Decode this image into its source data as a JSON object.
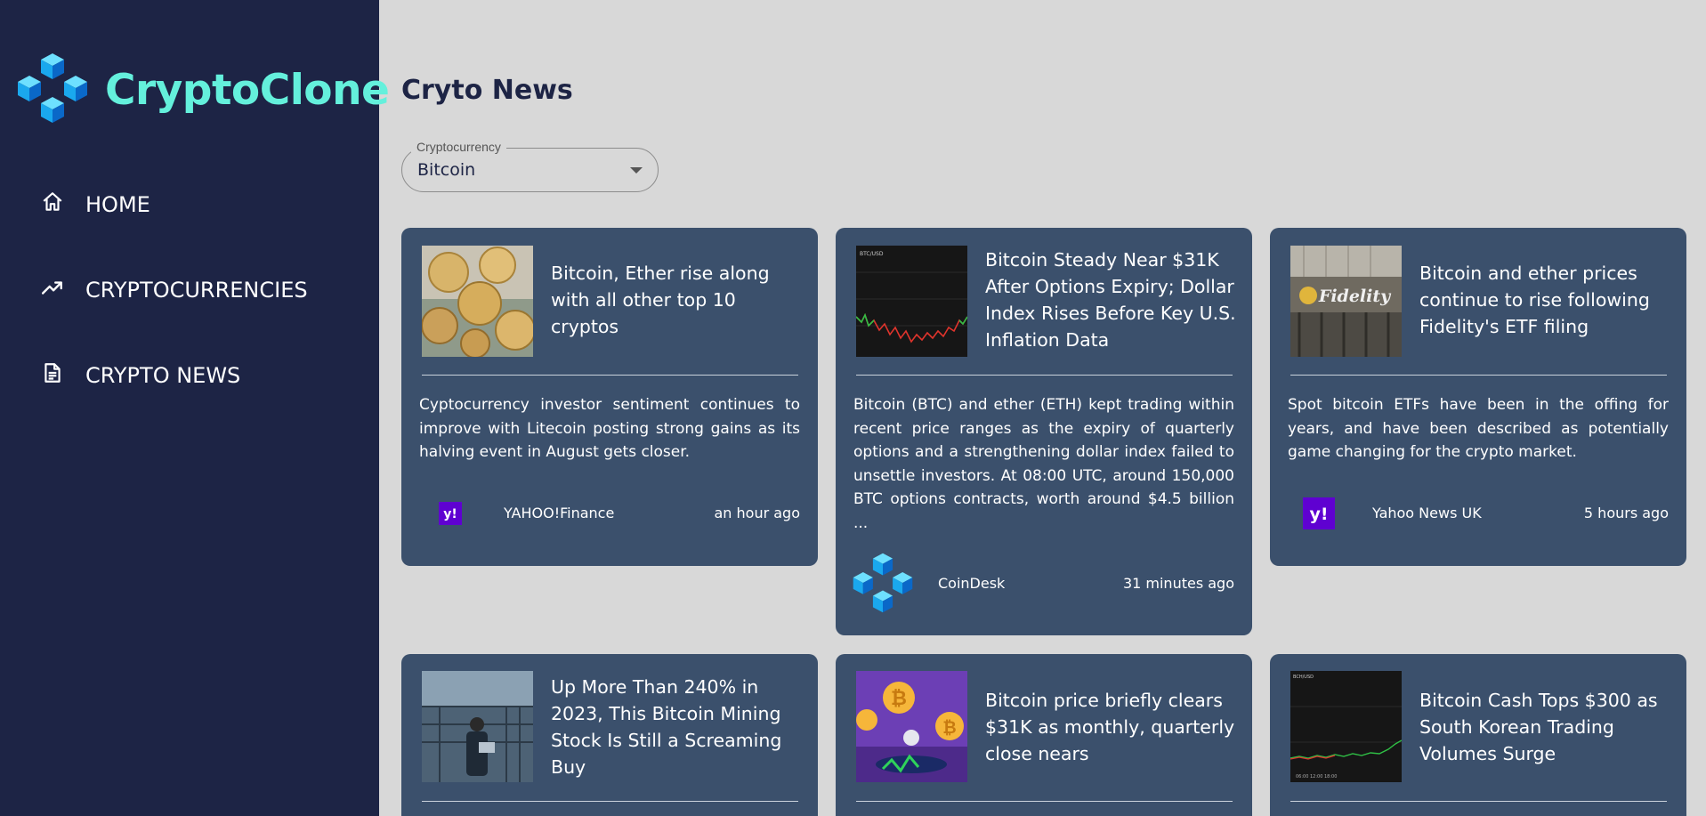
{
  "app": {
    "name": "CryptoClone"
  },
  "nav": {
    "home": "HOME",
    "cryptocurrencies": "CRYPTOCURRENCIES",
    "news": "CRYPTO NEWS"
  },
  "page": {
    "title": "Cryto News"
  },
  "filter": {
    "label": "Cryptocurrency",
    "value": "Bitcoin"
  },
  "colors": {
    "sidebar": "#1d2445",
    "logo_text": "#64f0dc",
    "card": "#3b506c",
    "background": "#d8d8d8"
  },
  "news": [
    {
      "title": "Bitcoin, Ether rise along with all other top 10 cryptos",
      "description": "Cyptocurrency investor sentiment continues to improve with Litecoin posting strong gains as its halving event in August gets closer.",
      "source": "YAHOO!Finance",
      "time": "an hour ago",
      "thumb_icon": "coins-image",
      "source_icon": "yahoo-finance-icon"
    },
    {
      "title": "Bitcoin Steady Near $31K After Options Expiry; Dollar Index Rises Before Key U.S. Inflation Data",
      "description": "Bitcoin (BTC) and ether (ETH) kept trading within recent price ranges as the expiry of quarterly options and a strengthening dollar index failed to unsettle investors. At 08:00 UTC, around 150,000 BTC options contracts, worth around $4.5 billion ...",
      "source": "CoinDesk",
      "time": "31 minutes ago",
      "thumb_icon": "price-chart-image",
      "source_icon": "coindesk-icon"
    },
    {
      "title": "Bitcoin and ether prices continue to rise following Fidelity's ETF filing",
      "description": "Spot bitcoin ETFs have been in the offing for years, and have been described as potentially game changing for the crypto market.",
      "source": "Yahoo News UK",
      "time": "5 hours ago",
      "thumb_icon": "fidelity-sign-image",
      "source_icon": "yahoo-news-icon"
    },
    {
      "title": "Up More Than 240% in 2023, This Bitcoin Mining Stock Is Still a Screaming Buy",
      "thumb_icon": "mining-farm-image"
    },
    {
      "title": "Bitcoin price briefly clears $31K as monthly, quarterly close nears",
      "thumb_icon": "bitcoin-illustration-image"
    },
    {
      "title": "Bitcoin Cash Tops $300 as South Korean Trading Volumes Surge",
      "thumb_icon": "volume-chart-image"
    }
  ]
}
